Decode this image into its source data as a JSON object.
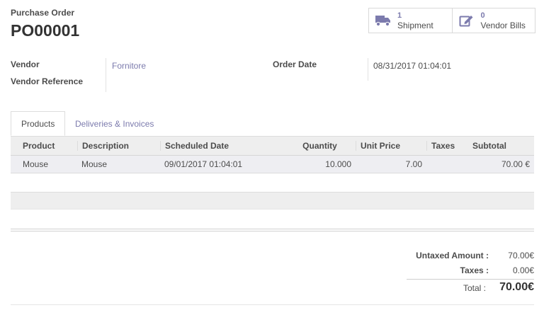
{
  "header": {
    "doc_label": "Purchase Order",
    "doc_name": "PO00001"
  },
  "smart_buttons": [
    {
      "count": "1",
      "label": "Shipment",
      "icon": "truck-icon"
    },
    {
      "count": "0",
      "label": "Vendor Bills",
      "icon": "edit-icon"
    }
  ],
  "fields": {
    "vendor_label": "Vendor",
    "vendor_value": "Fornitore",
    "vendor_ref_label": "Vendor Reference",
    "vendor_ref_value": "",
    "order_date_label": "Order Date",
    "order_date_value": "08/31/2017 01:04:01"
  },
  "tabs": [
    {
      "label": "Products",
      "active": true
    },
    {
      "label": "Deliveries & Invoices",
      "active": false
    }
  ],
  "table": {
    "columns": [
      "Product",
      "Description",
      "Scheduled Date",
      "Quantity",
      "Unit Price",
      "Taxes",
      "Subtotal"
    ],
    "rows": [
      [
        "Mouse",
        "Mouse",
        "09/01/2017 01:04:01",
        "10.000",
        "7.00",
        "",
        "70.00 €"
      ]
    ]
  },
  "totals": {
    "untaxed_label": "Untaxed Amount :",
    "untaxed_value": "70.00€",
    "taxes_label": "Taxes :",
    "taxes_value": "0.00€",
    "total_label": "Total :",
    "total_value": "70.00€"
  },
  "colors": {
    "accent": "#7c7bad",
    "text": "#4c4c4c",
    "header_bg": "#eeeeee"
  }
}
